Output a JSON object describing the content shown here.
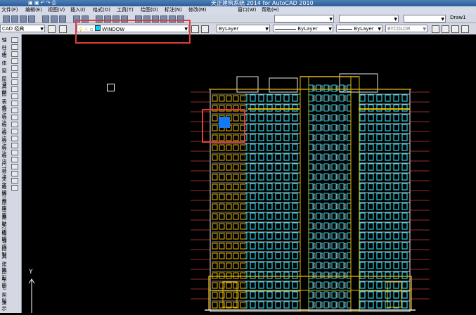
{
  "window": {
    "title": "天正建筑系统 2014 for AutoCAD 2010",
    "right_tag": "Draw1"
  },
  "menu": [
    "文件(F)",
    "编辑(E)",
    "视图(V)",
    "插入(I)",
    "格式(O)",
    "工具(T)",
    "绘图(D)",
    "标注(N)",
    "修改(M)",
    "窗口(W)",
    "帮助(H)"
  ],
  "workspace": {
    "value": "CAD 经典"
  },
  "layer": {
    "value": "WINDOW"
  },
  "props": {
    "color": "ByLayer",
    "linetype": "ByLayer",
    "lineweight": "ByLayer",
    "plotstyle": "BYCOLOR"
  },
  "left_labels": [
    "轴",
    "柱子",
    "墙",
    "体",
    "窗",
    "屋顶",
    "其他",
    "图",
    "表格",
    "标注",
    "标注",
    "标注",
    "标注",
    "标注",
    "标注",
    "标注",
    "尺寸",
    "标注",
    "文字",
    "编辑",
    "符号",
    "图库",
    "设置",
    "帮助",
    "关闭",
    "编辑",
    "轴线",
    "控制",
    "具",
    "建筑",
    "图形",
    "布图",
    "它",
    "帮助",
    "演示"
  ],
  "ucs": {
    "label": "Y"
  },
  "colors": {
    "highlight": "#e23b3b",
    "cursor": "#1478f0",
    "cad_bg": "#000000"
  }
}
